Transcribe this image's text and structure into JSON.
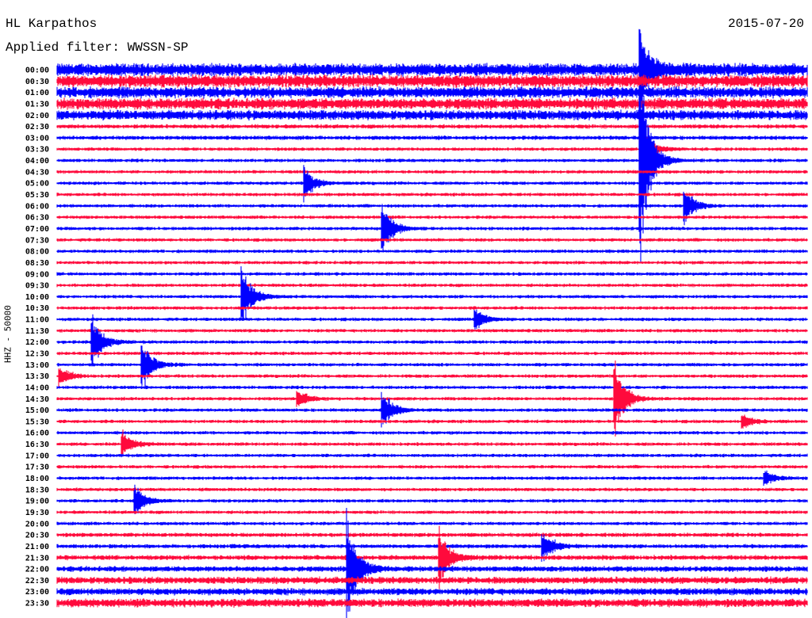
{
  "header": {
    "station": "HL Karpathos",
    "filter": "Applied filter: WWSSN-SP",
    "date": "2015-07-20"
  },
  "chart_data": {
    "type": "line",
    "title": "HL Karpathos",
    "subtitle": "Applied filter: WWSSN-SP",
    "ylabel": "HHZ - 50000",
    "xlabel": "",
    "row_minutes": 30,
    "colors": [
      "#0000ff",
      "#ff0a3c"
    ],
    "row_labels": [
      "00:00",
      "00:30",
      "01:00",
      "01:30",
      "02:00",
      "02:30",
      "03:00",
      "03:30",
      "04:00",
      "04:30",
      "05:00",
      "05:30",
      "06:00",
      "06:30",
      "07:00",
      "07:30",
      "08:00",
      "08:30",
      "09:00",
      "09:30",
      "10:00",
      "10:30",
      "11:00",
      "11:30",
      "12:00",
      "12:30",
      "13:00",
      "13:30",
      "14:00",
      "14:30",
      "15:00",
      "15:30",
      "16:00",
      "16:30",
      "17:00",
      "17:30",
      "18:00",
      "18:30",
      "19:00",
      "19:30",
      "20:00",
      "20:30",
      "21:00",
      "21:30",
      "22:00",
      "22:30",
      "23:00",
      "23:30"
    ],
    "noise_levels": [
      9,
      9,
      8,
      8,
      7,
      3,
      3,
      2.5,
      2.5,
      2.5,
      2.5,
      2.5,
      2.5,
      2.5,
      2.5,
      2.5,
      2.5,
      2.5,
      2.5,
      2.5,
      2.5,
      2.5,
      2.5,
      2.5,
      2.5,
      2.5,
      2.5,
      2.5,
      2.5,
      2.5,
      2.5,
      2.5,
      2.5,
      2.5,
      2.5,
      2.5,
      2.5,
      2.5,
      2.5,
      2.5,
      2.5,
      3,
      3,
      3.5,
      4,
      5,
      5,
      6
    ],
    "events": [
      {
        "row": 0,
        "minute": 23.3,
        "amplitude": 60
      },
      {
        "row": 7,
        "minute": 23.3,
        "amplitude": 40
      },
      {
        "row": 8,
        "minute": 23.3,
        "amplitude": 150
      },
      {
        "row": 10,
        "minute": 9.9,
        "amplitude": 25
      },
      {
        "row": 12,
        "minute": 25.1,
        "amplitude": 25
      },
      {
        "row": 14,
        "minute": 13.0,
        "amplitude": 40
      },
      {
        "row": 20,
        "minute": 7.4,
        "amplitude": 45
      },
      {
        "row": 22,
        "minute": 16.7,
        "amplitude": 18
      },
      {
        "row": 24,
        "minute": 1.4,
        "amplitude": 40
      },
      {
        "row": 26,
        "minute": 3.4,
        "amplitude": 35
      },
      {
        "row": 27,
        "minute": 0.1,
        "amplitude": 15
      },
      {
        "row": 29,
        "minute": 9.6,
        "amplitude": 15
      },
      {
        "row": 29,
        "minute": 22.3,
        "amplitude": 60
      },
      {
        "row": 30,
        "minute": 13.0,
        "amplitude": 30
      },
      {
        "row": 31,
        "minute": 27.4,
        "amplitude": 12
      },
      {
        "row": 33,
        "minute": 2.6,
        "amplitude": 20
      },
      {
        "row": 36,
        "minute": 28.3,
        "amplitude": 12
      },
      {
        "row": 38,
        "minute": 3.1,
        "amplitude": 25
      },
      {
        "row": 42,
        "minute": 19.4,
        "amplitude": 25
      },
      {
        "row": 43,
        "minute": 15.3,
        "amplitude": 40
      },
      {
        "row": 44,
        "minute": 11.6,
        "amplitude": 80
      }
    ]
  }
}
